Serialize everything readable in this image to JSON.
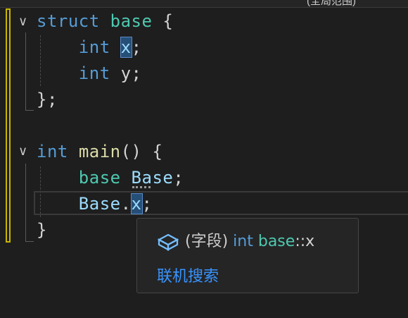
{
  "window": {
    "tab_fragment": "(全局范围)"
  },
  "editor": {
    "lines": [
      {
        "tokens": [
          {
            "t": "struct",
            "c": "kw"
          },
          {
            "t": " ",
            "c": "plain"
          },
          {
            "t": "base",
            "c": "type"
          },
          {
            "t": " {",
            "c": "plain"
          }
        ]
      },
      {
        "tokens": [
          {
            "t": "    ",
            "c": "plain"
          },
          {
            "t": "int",
            "c": "kw"
          },
          {
            "t": " ",
            "c": "plain"
          },
          {
            "t": "x",
            "c": "var sel"
          },
          {
            "t": ";",
            "c": "plain"
          }
        ]
      },
      {
        "tokens": [
          {
            "t": "    ",
            "c": "plain"
          },
          {
            "t": "int",
            "c": "kw"
          },
          {
            "t": " y;",
            "c": "plain"
          }
        ]
      },
      {
        "tokens": [
          {
            "t": "};",
            "c": "plain"
          }
        ]
      },
      {
        "tokens": []
      },
      {
        "tokens": [
          {
            "t": "int",
            "c": "kw"
          },
          {
            "t": " ",
            "c": "plain"
          },
          {
            "t": "main",
            "c": "fn"
          },
          {
            "t": "() {",
            "c": "plain"
          }
        ]
      },
      {
        "tokens": [
          {
            "t": "    ",
            "c": "plain"
          },
          {
            "t": "base",
            "c": "type"
          },
          {
            "t": " ",
            "c": "plain"
          },
          {
            "t": "Base",
            "c": "var"
          },
          {
            "t": ";",
            "c": "plain"
          }
        ]
      },
      {
        "tokens": [
          {
            "t": "    ",
            "c": "plain"
          },
          {
            "t": "Base",
            "c": "var"
          },
          {
            "t": ".",
            "c": "plain"
          },
          {
            "t": "x",
            "c": "var sel"
          },
          {
            "t": ";",
            "c": "plain"
          }
        ]
      },
      {
        "tokens": [
          {
            "t": "}",
            "c": "plain"
          }
        ]
      }
    ],
    "fold_glyph": "∨"
  },
  "tooltip": {
    "icon": "field-icon",
    "kind": "(字段)",
    "kw": "int",
    "type": "base",
    "sep": "::",
    "member": "x",
    "link": "联机搜索"
  },
  "colors": {
    "keyword": "#569cd6",
    "type": "#4ec9b0",
    "function": "#dcdcaa",
    "variable": "#9cdcfe",
    "change_bar": "#c8b400",
    "selection": "#264f78"
  }
}
